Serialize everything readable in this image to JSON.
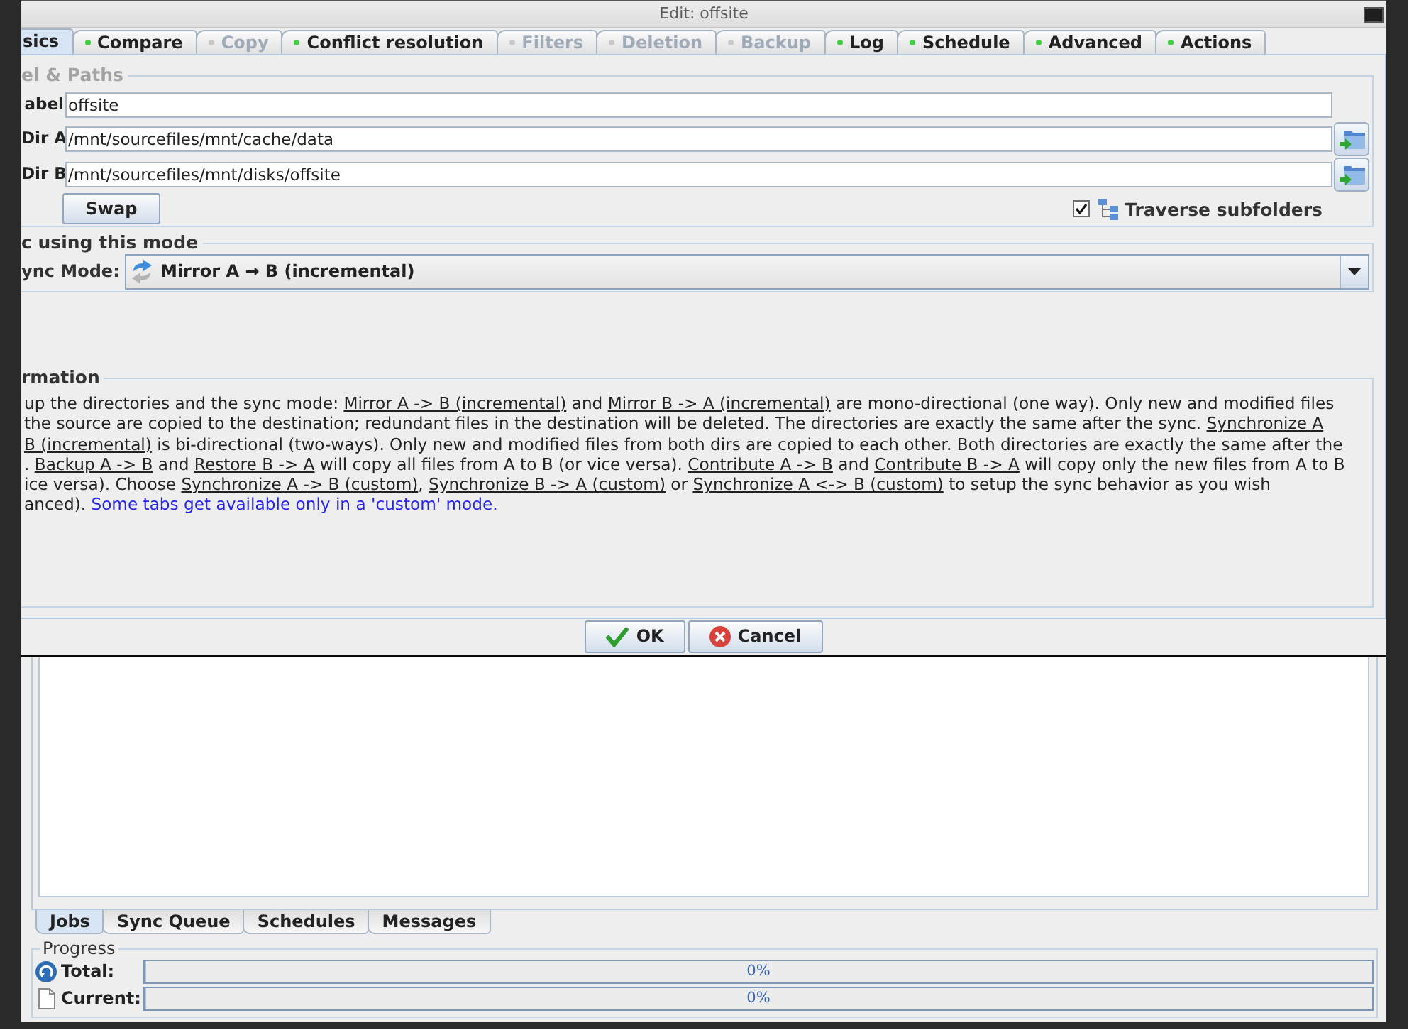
{
  "dialog": {
    "title": "Edit: offsite",
    "tabs": [
      {
        "label": "sics",
        "dot": false,
        "enabled": true,
        "selected": true
      },
      {
        "label": "Compare",
        "dot": true,
        "enabled": true,
        "selected": false
      },
      {
        "label": "Copy",
        "dot": true,
        "enabled": false,
        "selected": false
      },
      {
        "label": "Conflict resolution",
        "dot": true,
        "enabled": true,
        "selected": false
      },
      {
        "label": "Filters",
        "dot": true,
        "enabled": false,
        "selected": false
      },
      {
        "label": "Deletion",
        "dot": true,
        "enabled": false,
        "selected": false
      },
      {
        "label": "Backup",
        "dot": true,
        "enabled": false,
        "selected": false
      },
      {
        "label": "Log",
        "dot": true,
        "enabled": true,
        "selected": false
      },
      {
        "label": "Schedule",
        "dot": true,
        "enabled": true,
        "selected": false
      },
      {
        "label": "Advanced",
        "dot": true,
        "enabled": true,
        "selected": false
      },
      {
        "label": "Actions",
        "dot": true,
        "enabled": true,
        "selected": false
      }
    ],
    "paths_group": {
      "title": "el & Paths",
      "disabled": true,
      "fields": [
        {
          "label": "abel",
          "value": "offsite",
          "browse": false
        },
        {
          "label": "Dir A",
          "value": "/mnt/sourcefiles/mnt/cache/data",
          "browse": true
        },
        {
          "label": "Dir B",
          "value": "/mnt/sourcefiles/mnt/disks/offsite",
          "browse": true
        }
      ],
      "swap_button": "Swap",
      "traverse": {
        "label": "Traverse subfolders",
        "checked": true
      }
    },
    "mode_group": {
      "title": "c using this mode",
      "disabled": false,
      "label": "ync Mode:",
      "value": "Mirror A → B (incremental)"
    },
    "info_group": {
      "title": "rmation",
      "disabled": false,
      "lines": [
        [
          {
            "kind": "text",
            "text": "up the directories and the sync mode: "
          },
          {
            "kind": "link",
            "text": "Mirror A -> B (incremental)"
          },
          {
            "kind": "text",
            "text": " and "
          },
          {
            "kind": "link",
            "text": "Mirror B -> A (incremental)"
          },
          {
            "kind": "text",
            "text": " are mono-directional (one way). Only new and modified files"
          }
        ],
        [
          {
            "kind": "text",
            "text": "the source are copied to the destination; redundant files in the destination will be deleted. The directories are exactly the same after the sync. "
          },
          {
            "kind": "link",
            "text": "Synchronize A"
          }
        ],
        [
          {
            "kind": "link",
            "text": "B (incremental)"
          },
          {
            "kind": "text",
            "text": " is bi-directional (two-ways). Only new and modified files from both dirs are copied to each other. Both directories are exactly the same after the"
          }
        ],
        [
          {
            "kind": "text",
            "text": ". "
          },
          {
            "kind": "link",
            "text": "Backup A -> B"
          },
          {
            "kind": "text",
            "text": " and "
          },
          {
            "kind": "link",
            "text": "Restore B -> A"
          },
          {
            "kind": "text",
            "text": " will copy all files from A to B (or vice versa). "
          },
          {
            "kind": "link",
            "text": "Contribute A -> B"
          },
          {
            "kind": "text",
            "text": " and "
          },
          {
            "kind": "link",
            "text": "Contribute B -> A"
          },
          {
            "kind": "text",
            "text": " will copy only the new files from A to B"
          }
        ],
        [
          {
            "kind": "text",
            "text": "ice versa). Choose "
          },
          {
            "kind": "link",
            "text": "Synchronize A -> B (custom)"
          },
          {
            "kind": "text",
            "text": ", "
          },
          {
            "kind": "link",
            "text": "Synchronize B -> A (custom)"
          },
          {
            "kind": "text",
            "text": " or "
          },
          {
            "kind": "link",
            "text": "Synchronize A <-> B (custom)"
          },
          {
            "kind": "text",
            "text": " to setup the sync behavior as you wish"
          }
        ],
        [
          {
            "kind": "text",
            "text": "anced). "
          },
          {
            "kind": "note",
            "text": "Some tabs get available only in a 'custom' mode."
          }
        ]
      ]
    },
    "buttons": [
      {
        "kind": "ok",
        "label": "OK"
      },
      {
        "kind": "cancel",
        "label": "Cancel"
      }
    ]
  },
  "main_window": {
    "tabs": [
      {
        "label": "Jobs",
        "selected": true
      },
      {
        "label": "Sync Queue",
        "selected": false
      },
      {
        "label": "Schedules",
        "selected": false
      },
      {
        "label": "Messages",
        "selected": false
      }
    ],
    "progress": {
      "title": "Progress",
      "rows": [
        {
          "kind": "total",
          "label": "Total:",
          "level": 0,
          "reading": "0%"
        },
        {
          "kind": "current",
          "label": "Current:",
          "level": 0,
          "reading": "0%"
        }
      ]
    }
  }
}
